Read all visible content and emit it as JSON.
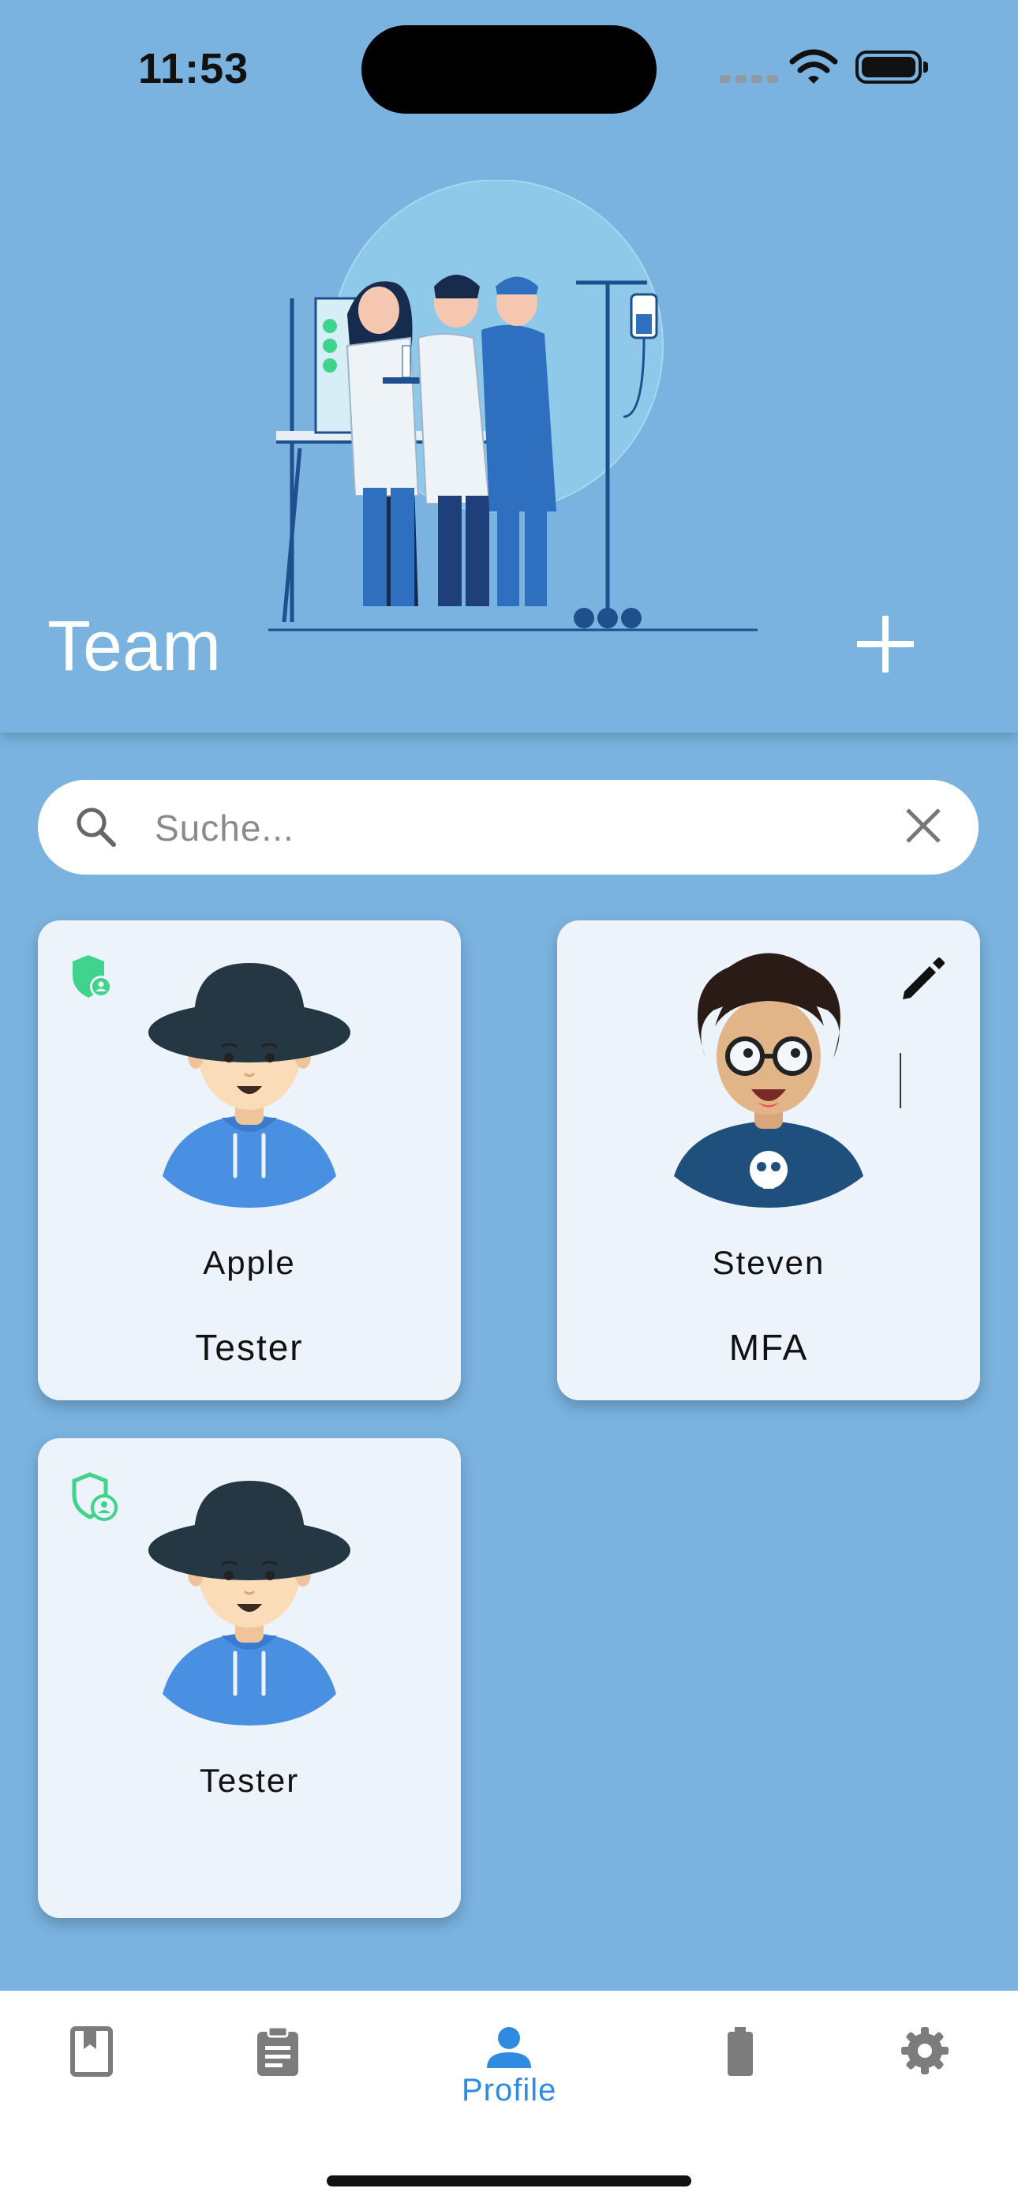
{
  "status_bar": {
    "time": "11:53"
  },
  "header": {
    "title": "Team"
  },
  "search": {
    "placeholder": "Suche..."
  },
  "cards": [
    {
      "name": "Apple",
      "role": "Tester",
      "badge": "admin-shield-filled"
    },
    {
      "name": "Steven",
      "role": "MFA",
      "action": "edit"
    },
    {
      "name": "Tester",
      "role": "",
      "badge": "admin-shield-outline"
    }
  ],
  "nav": {
    "items": [
      {
        "icon": "bookmark-book-icon",
        "label": ""
      },
      {
        "icon": "clipboard-icon",
        "label": ""
      },
      {
        "icon": "person-icon",
        "label": "Profile",
        "active": true
      },
      {
        "icon": "battery-icon",
        "label": ""
      },
      {
        "icon": "gear-icon",
        "label": ""
      }
    ]
  },
  "colors": {
    "background": "#7ab3df",
    "card": "#edf3fa",
    "accent": "#2f8be0",
    "badge": "#3fd38c"
  }
}
